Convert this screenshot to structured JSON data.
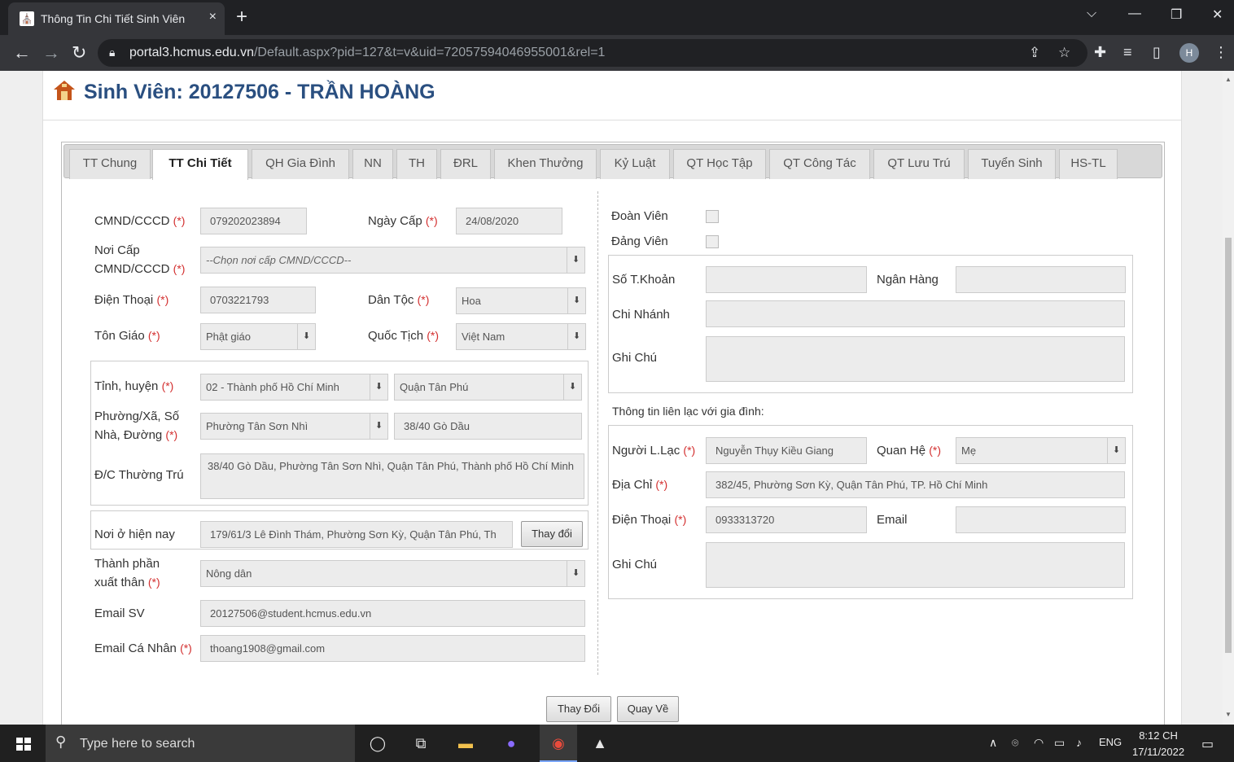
{
  "browser": {
    "tab_title": "Thông Tin Chi Tiết Sinh Viên",
    "tab_close": "×",
    "new_tab": "+",
    "url_host": "portal3.hcmus.edu.vn",
    "url_path": "/Default.aspx?pid=127&t=v&uid=72057594046955001&rel=1",
    "profile_initial": "H"
  },
  "page": {
    "title": "Sinh Viên: 20127506 - TRẦN HOÀNG"
  },
  "tabs": [
    {
      "label": "TT Chung"
    },
    {
      "label": "TT Chi Tiết"
    },
    {
      "label": "QH Gia Đình"
    },
    {
      "label": "NN"
    },
    {
      "label": "TH"
    },
    {
      "label": "ĐRL"
    },
    {
      "label": "Khen Thưởng"
    },
    {
      "label": "Kỷ Luật"
    },
    {
      "label": "QT Học Tập"
    },
    {
      "label": "QT Công Tác"
    },
    {
      "label": "QT Lưu Trú"
    },
    {
      "label": "Tuyển Sinh"
    },
    {
      "label": "HS-TL"
    }
  ],
  "required_mark": "(*)",
  "left": {
    "cmnd_label": "CMND/CCCD",
    "cmnd_value": "079202023894",
    "ngay_cap_label": "Ngày Cấp",
    "ngay_cap_value": "24/08/2020",
    "noi_cap_label_1": "Nơi Cấp",
    "noi_cap_label_2": "CMND/CCCD",
    "noi_cap_placeholder": "--Chọn nơi cấp CMND/CCCD--",
    "dien_thoai_label": "Điện Thoại",
    "dien_thoai_value": "0703221793",
    "dan_toc_label": "Dân Tộc",
    "dan_toc_value": "Hoa",
    "ton_giao_label": "Tôn Giáo",
    "ton_giao_value": "Phật giáo",
    "quoc_tich_label": "Quốc Tịch",
    "quoc_tich_value": "Việt Nam",
    "tinh_huyen_label": "Tỉnh, huyện",
    "tinh_value": "02 - Thành phố Hồ Chí Minh",
    "huyen_value": "Quận Tân Phú",
    "phuong_label_1": "Phường/Xã, Số",
    "phuong_label_2": "Nhà, Đường",
    "phuong_value": "Phường Tân Sơn Nhì",
    "so_nha_value": "38/40 Gò Dầu",
    "dc_thuong_tru_label": "Đ/C Thường Trú",
    "dc_thuong_tru_value": "38/40 Gò Dầu, Phường Tân Sơn Nhì, Quận Tân Phú, Thành phố Hồ Chí Minh",
    "noi_o_label": "Nơi ở hiện nay",
    "noi_o_value": "179/61/3 Lê Đình Thám, Phường Sơn Kỳ, Quận Tân Phú, Th",
    "thay_doi_small": "Thay đổi",
    "thanh_phan_label_1": "Thành phần",
    "thanh_phan_label_2": "xuất thân",
    "thanh_phan_value": "Nông dân",
    "email_sv_label": "Email SV",
    "email_sv_value": "20127506@student.hcmus.edu.vn",
    "email_cn_label": "Email Cá Nhân",
    "email_cn_value": "thoang1908@gmail.com"
  },
  "right": {
    "doan_vien_label": "Đoàn Viên",
    "dang_vien_label": "Đảng Viên",
    "so_tk_label": "Số T.Khoản",
    "so_tk_value": "",
    "ngan_hang_label": "Ngân Hàng",
    "ngan_hang_value": "",
    "chi_nhanh_label": "Chi Nhánh",
    "chi_nhanh_value": "",
    "ghi_chu_label": "Ghi Chú",
    "ghi_chu_value": "",
    "lien_lac_heading": "Thông tin liên lạc với gia đình:",
    "nguoi_ll_label": "Người L.Lạc",
    "nguoi_ll_value": "Nguyễn Thụy Kiều Giang",
    "quan_he_label": "Quan Hệ",
    "quan_he_value": "Mẹ",
    "dia_chi_label": "Địa Chỉ",
    "dia_chi_value": "382/45, Phường Sơn Kỳ, Quận Tân Phú, TP. Hồ Chí Minh",
    "dien_thoai_label": "Điện Thoại",
    "dien_thoai_value": "0933313720",
    "email_label": "Email",
    "email_value": "",
    "ghi_chu2_label": "Ghi Chú",
    "ghi_chu2_value": ""
  },
  "actions": {
    "thay_doi": "Thay Đổi",
    "quay_ve": "Quay Về"
  },
  "taskbar": {
    "search_placeholder": "Type here to search",
    "lang": "ENG",
    "time": "8:12 CH",
    "date": "17/11/2022"
  },
  "colors": {
    "title_blue": "#2a4f80",
    "required_red": "#d32f2f"
  }
}
